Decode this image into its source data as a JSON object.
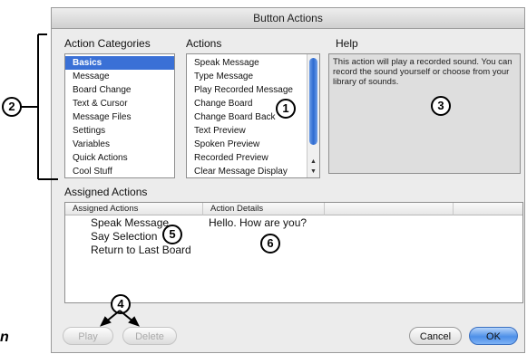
{
  "window": {
    "title": "Button Actions"
  },
  "headers": {
    "categories": "Action Categories",
    "actions": "Actions",
    "help": "Help",
    "assigned": "Assigned Actions"
  },
  "categories": [
    "Basics",
    "Message",
    "Board Change",
    "Text & Cursor",
    "Message Files",
    "Settings",
    "Variables",
    "Quick Actions",
    "Cool Stuff"
  ],
  "selected_category": "Basics",
  "actions": [
    "Speak Message",
    "Type Message",
    "Play Recorded Message",
    "Change Board",
    "Change Board Back",
    "Text Preview",
    "Spoken Preview",
    "Recorded Preview",
    "Clear Message Display"
  ],
  "help_text": "This action will play a recorded sound. You can record the sound yourself or choose from your library of sounds.",
  "assigned_table": {
    "columns": [
      "Assigned Actions",
      "Action Details"
    ],
    "rows": [
      {
        "action": "Speak Message",
        "details": "Hello.  How are you?"
      },
      {
        "action": "Say Selection",
        "details": ""
      },
      {
        "action": "Return to Last Board",
        "details": ""
      }
    ]
  },
  "buttons": {
    "play": "Play",
    "delete": "Delete",
    "cancel": "Cancel",
    "ok": "OK"
  },
  "callouts": [
    "1",
    "2",
    "3",
    "4",
    "5",
    "6"
  ],
  "edge_label": "n",
  "colors": {
    "selection": "#3a70d6",
    "ok_button": "#4d8fe8",
    "window_bg": "#ececec"
  },
  "icons": {
    "scroll_up": "up-arrow-icon",
    "scroll_down": "down-arrow-icon"
  }
}
